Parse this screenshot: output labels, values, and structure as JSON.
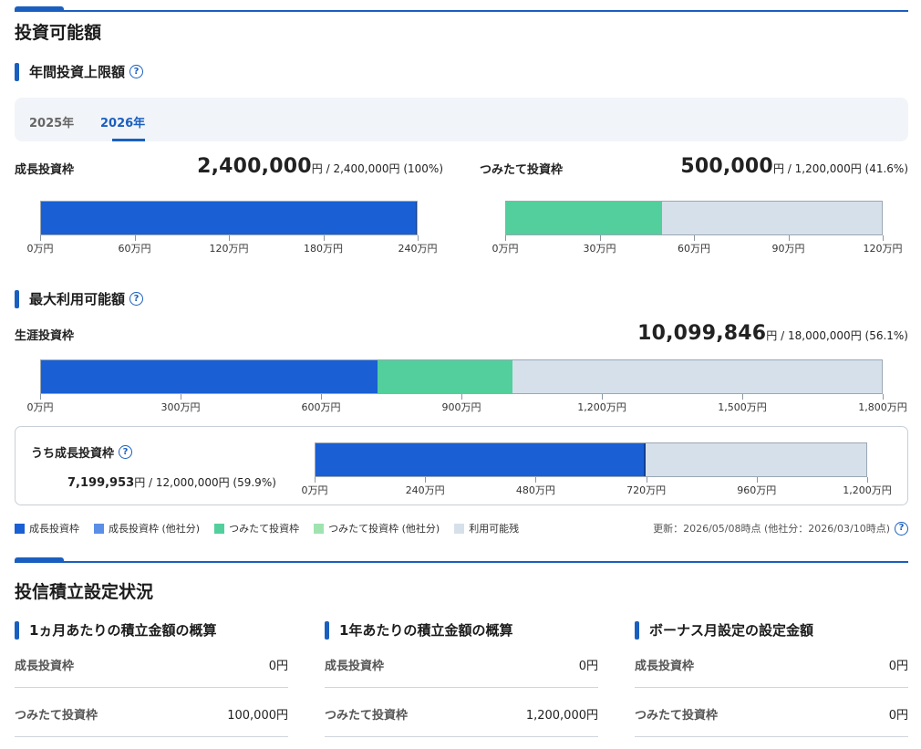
{
  "investable": {
    "title": "投資可能額",
    "annual_limit": {
      "title": "年間投資上限額",
      "help": "?",
      "tabs": [
        {
          "label": "2025年",
          "active": false
        },
        {
          "label": "2026年",
          "active": true
        }
      ],
      "growth": {
        "label": "成長投資枠",
        "used": "2,400,000",
        "unit": "円",
        "detail": " / 2,400,000円 (100%)",
        "used_fraction": 1.0,
        "ticks": [
          "0万円",
          "60万円",
          "120万円",
          "180万円",
          "240万円"
        ]
      },
      "tsumitate": {
        "label": "つみたて投資枠",
        "used": "500,000",
        "unit": "円",
        "detail": " / 1,200,000円 (41.6%)",
        "used_fraction": 0.416,
        "ticks": [
          "0万円",
          "30万円",
          "60万円",
          "90万円",
          "120万円"
        ]
      }
    },
    "max_usable": {
      "title": "最大利用可能額",
      "help": "?",
      "lifetime": {
        "label": "生涯投資枠",
        "used": "10,099,846",
        "unit": "円",
        "detail": " / 18,000,000円 (56.1%)",
        "growth_fraction": 0.4,
        "tsumitate_fraction": 0.161,
        "ticks": [
          "0万円",
          "300万円",
          "600万円",
          "900万円",
          "1,200万円",
          "1,500万円",
          "1,800万円"
        ]
      },
      "growth_sub": {
        "label": "うち成長投資枠",
        "help": "?",
        "used": "7,199,953",
        "unit": "円",
        "detail": " / 12,000,000円 (59.9%)",
        "used_fraction": 0.599,
        "ticks": [
          "0万円",
          "240万円",
          "480万円",
          "720万円",
          "960万円",
          "1,200万円"
        ]
      }
    },
    "legend": [
      {
        "label": "成長投資枠",
        "color": "#1a5fd4"
      },
      {
        "label": "成長投資枠 (他社分)",
        "color": "#5b8ee6"
      },
      {
        "label": "つみたて投資枠",
        "color": "#52cf9c"
      },
      {
        "label": "つみたて投資枠 (他社分)",
        "color": "#9fe3b1"
      },
      {
        "label": "利用可能残",
        "color": "#d6e0ea"
      }
    ],
    "updated": "更新：2026/05/08時点 (他社分：2026/03/10時点)",
    "updated_help": "?"
  },
  "settings": {
    "title": "投信積立設定状況",
    "cards": [
      {
        "title": "1ヵ月あたりの積立金額の概算",
        "rows": [
          {
            "label": "成長投資枠",
            "value": "0円"
          },
          {
            "label": "つみたて投資枠",
            "value": "100,000円"
          }
        ]
      },
      {
        "title": "1年あたりの積立金額の概算",
        "rows": [
          {
            "label": "成長投資枠",
            "value": "0円"
          },
          {
            "label": "つみたて投資枠",
            "value": "1,200,000円"
          }
        ]
      },
      {
        "title": "ボーナス月設定の設定金額",
        "rows": [
          {
            "label": "成長投資枠",
            "value": "0円"
          },
          {
            "label": "つみたて投資枠",
            "value": "0円"
          }
        ]
      }
    ]
  }
}
